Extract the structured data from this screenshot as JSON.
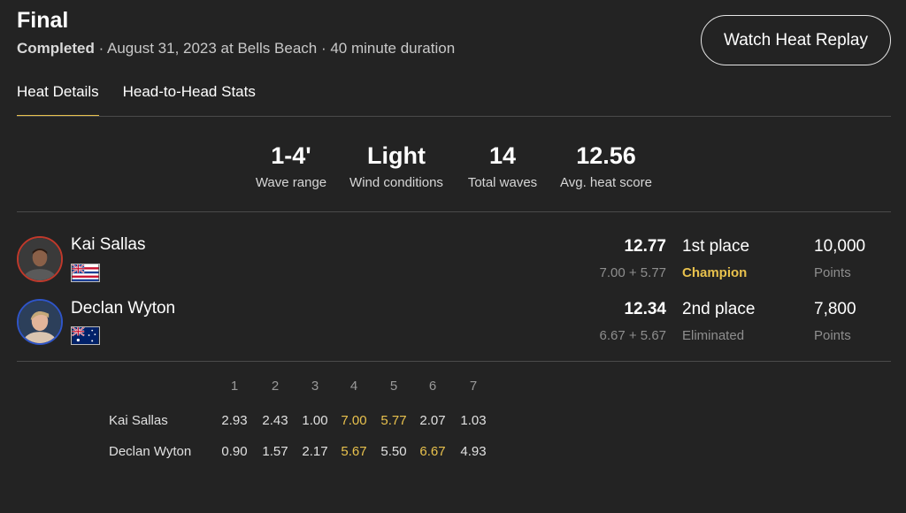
{
  "header": {
    "title": "Final",
    "status": "Completed",
    "details": " · August 31, 2023 at Bells Beach · 40 minute duration",
    "replay_label": "Watch Heat Replay"
  },
  "tabs": [
    {
      "label": "Heat Details",
      "active": true
    },
    {
      "label": "Head-to-Head Stats",
      "active": false
    }
  ],
  "stats": [
    {
      "value": "1-4'",
      "label": "Wave range"
    },
    {
      "value": "Light",
      "label": "Wind conditions"
    },
    {
      "value": "14",
      "label": "Total waves"
    },
    {
      "value": "12.56",
      "label": "Avg. heat score"
    }
  ],
  "surfers": [
    {
      "name": "Kai Sallas",
      "flag": "hawaii-flag",
      "total": "12.77",
      "split": "7.00 + 5.77",
      "place": "1st place",
      "result": "Champion",
      "points": "10,000",
      "points_label": "Points",
      "ring_color": "#c0392b"
    },
    {
      "name": "Declan Wyton",
      "flag": "australia-flag",
      "total": "12.34",
      "split": "6.67 + 5.67",
      "place": "2nd place",
      "result": "Eliminated",
      "points": "7,800",
      "points_label": "Points",
      "ring_color": "#2f55c8"
    }
  ],
  "waves": {
    "headers": [
      "1",
      "2",
      "3",
      "4",
      "5",
      "6",
      "7"
    ],
    "rows": [
      {
        "name": "Kai Sallas",
        "scores": [
          "2.93",
          "2.43",
          "1.00",
          "7.00",
          "5.77",
          "2.07",
          "1.03"
        ],
        "counting": [
          3,
          4
        ]
      },
      {
        "name": "Declan Wyton",
        "scores": [
          "0.90",
          "1.57",
          "2.17",
          "5.67",
          "5.50",
          "6.67",
          "4.93"
        ],
        "counting": [
          3,
          5
        ]
      }
    ]
  },
  "colors": {
    "accent": "#e8c14d",
    "background": "#232323",
    "muted": "#8e8e8e"
  }
}
